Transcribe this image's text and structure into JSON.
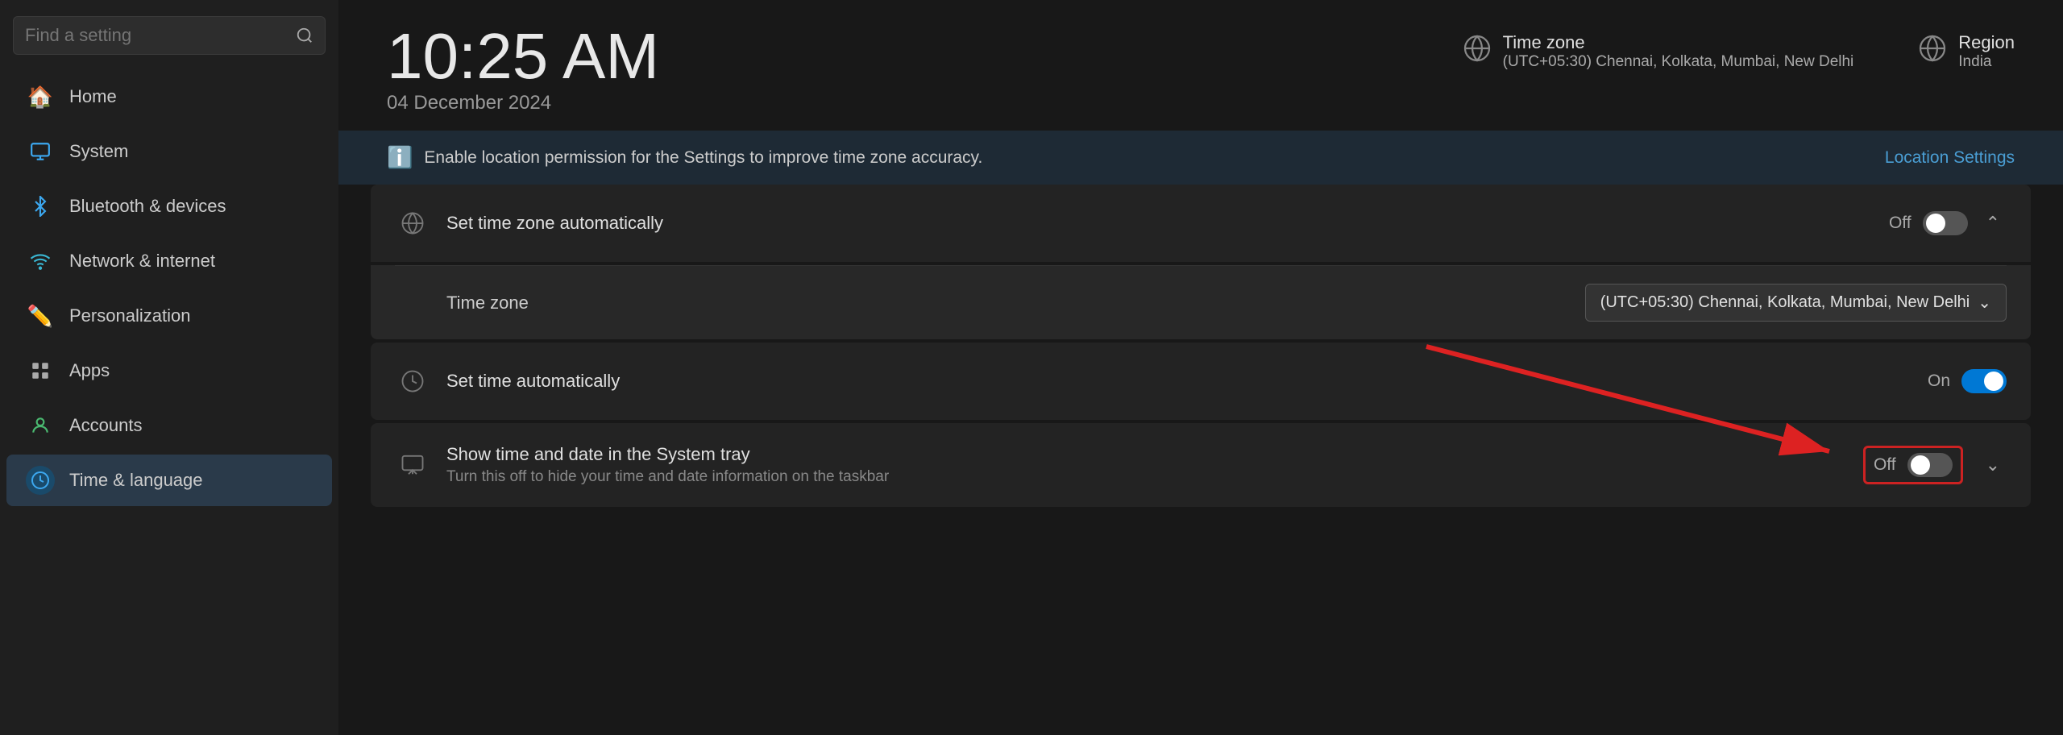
{
  "sidebar": {
    "search_placeholder": "Find a setting",
    "items": [
      {
        "label": "Home",
        "icon": "home",
        "id": "home"
      },
      {
        "label": "System",
        "icon": "system",
        "id": "system"
      },
      {
        "label": "Bluetooth & devices",
        "icon": "bluetooth",
        "id": "bluetooth"
      },
      {
        "label": "Network & internet",
        "icon": "network",
        "id": "network"
      },
      {
        "label": "Personalization",
        "icon": "personalization",
        "id": "personalization"
      },
      {
        "label": "Apps",
        "icon": "apps",
        "id": "apps"
      },
      {
        "label": "Accounts",
        "icon": "accounts",
        "id": "accounts"
      },
      {
        "label": "Time & language",
        "icon": "time",
        "id": "time"
      }
    ]
  },
  "header": {
    "time": "10:25 AM",
    "date": "04 December 2024",
    "timezone_label": "Time zone",
    "timezone_value": "(UTC+05:30) Chennai, Kolkata, Mumbai, New Delhi",
    "region_label": "Region",
    "region_value": "India"
  },
  "location_bar": {
    "message": "Enable location permission for the Settings to improve time zone accuracy.",
    "link_text": "Location Settings"
  },
  "settings": [
    {
      "id": "set-timezone-auto",
      "icon": "🌐",
      "title": "Set time zone automatically",
      "status": "Off",
      "toggle_state": "off",
      "expanded": true,
      "chevron": "up"
    },
    {
      "id": "timezone-sub",
      "type": "sub",
      "label": "Time zone",
      "dropdown_value": "(UTC+05:30) Chennai, Kolkata, Mumbai, New Delhi"
    },
    {
      "id": "set-time-auto",
      "icon": "🕐",
      "title": "Set time automatically",
      "status": "On",
      "toggle_state": "on"
    },
    {
      "id": "show-tray",
      "icon": "🗓",
      "title": "Show time and date in the System tray",
      "subtitle": "Turn this off to hide your time and date information on the taskbar",
      "status": "Off",
      "toggle_state": "off",
      "has_chevron": true
    }
  ]
}
